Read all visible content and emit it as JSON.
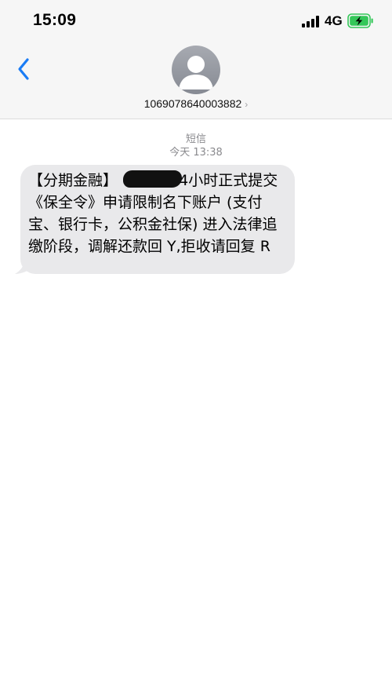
{
  "status_bar": {
    "time": "15:09",
    "network": "4G",
    "signal_icon": "cellular-signal-icon",
    "battery_icon": "battery-charging-icon"
  },
  "header": {
    "back_icon": "chevron-left-icon",
    "avatar_icon": "person-silhouette-icon",
    "contact": "1069078640003882",
    "contact_chevron": "›"
  },
  "conversation": {
    "channel": "短信",
    "timestamp": "今天 13:38",
    "messages": [
      {
        "direction": "incoming",
        "text_before": "【分期金融】",
        "text_after": "24小时正式提交《保全令》申请限制名下账户 (支付宝、银行卡，公积金社保) 进入法律追缴阶段，调解还款回 Y,拒收请回复 R"
      }
    ]
  },
  "colors": {
    "header_bg": "#f6f6f6",
    "accent": "#1a7cf5",
    "bubble_bg": "#e9e9eb",
    "battery": "#34c759"
  }
}
